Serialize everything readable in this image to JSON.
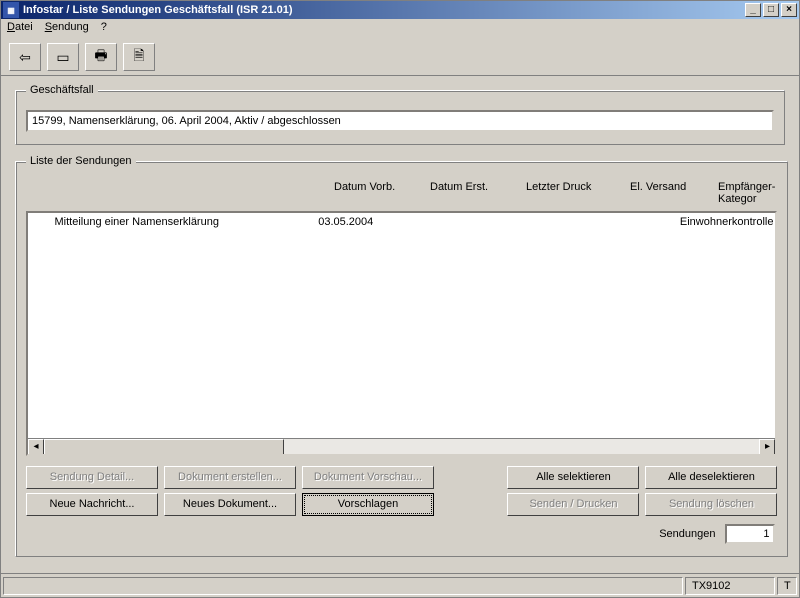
{
  "window": {
    "title": "Infostar / Liste Sendungen Geschäftsfall (ISR 21.01)",
    "minimize": "_",
    "maximize": "□",
    "close": "×"
  },
  "menu": {
    "datei": "Datei",
    "sendung": "Sendung",
    "help": "?"
  },
  "toolbar": {
    "back": "⇦",
    "card": "▭",
    "print": "🖶",
    "doc": "🗎"
  },
  "geschaftsfall": {
    "legend": "Geschäftsfall",
    "value": "15799, Namenserklärung, 06. April 2004, Aktiv / abgeschlossen"
  },
  "liste": {
    "legend": "Liste der Sendungen",
    "headers": {
      "datum_vorb": "Datum Vorb.",
      "datum_erst": "Datum Erst.",
      "letzter_druck": "Letzter Druck",
      "el_versand": "El. Versand",
      "empf_kat": "Empfänger-Kategor"
    },
    "rows": [
      {
        "name": "Mitteilung einer Namenserklärung",
        "datum_vorb": "03.05.2004",
        "datum_erst": "",
        "letzter_druck": "",
        "el_versand": "",
        "empf_kat": "Einwohnerkontrolle"
      }
    ]
  },
  "buttons": {
    "sendung_detail": "Sendung Detail...",
    "dokument_erstellen": "Dokument erstellen...",
    "dokument_vorschau": "Dokument Vorschau...",
    "alle_selektieren": "Alle selektieren",
    "alle_deselektieren": "Alle deselektieren",
    "neue_nachricht": "Neue Nachricht...",
    "neues_dokument": "Neues Dokument...",
    "vorschlagen": "Vorschlagen",
    "senden_drucken": "Senden / Drucken",
    "sendung_loeschen": "Sendung löschen"
  },
  "status_count": {
    "label": "Sendungen",
    "value": "1"
  },
  "statusbar": {
    "code": "TX9102",
    "mode": "T"
  }
}
